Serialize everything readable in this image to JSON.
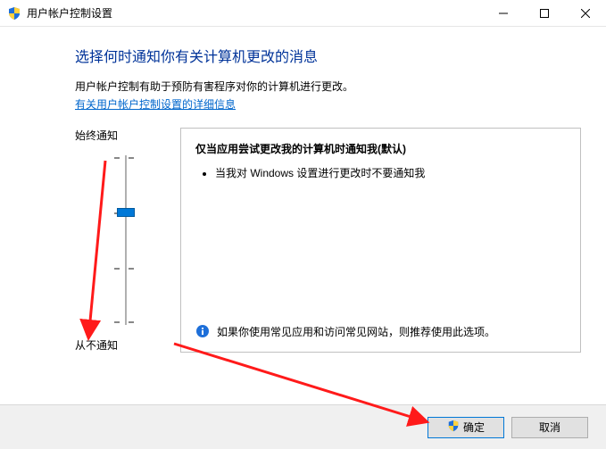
{
  "window": {
    "title": "用户帐户控制设置"
  },
  "heading": "选择何时通知你有关计算机更改的消息",
  "subtext": "用户帐户控制有助于预防有害程序对你的计算机进行更改。",
  "link": "有关用户帐户控制设置的详细信息",
  "slider": {
    "label_top": "始终通知",
    "label_bottom": "从不通知"
  },
  "description": {
    "title": "仅当应用尝试更改我的计算机时通知我(默认)",
    "bullet1": "当我对 Windows 设置进行更改时不要通知我",
    "recommend": "如果你使用常见应用和访问常见网站，则推荐使用此选项。"
  },
  "buttons": {
    "ok": "确定",
    "cancel": "取消"
  }
}
